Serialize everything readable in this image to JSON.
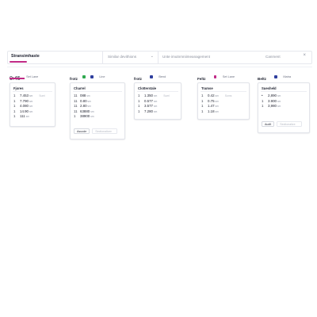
{
  "toolbar": {
    "search_label": "Stransimhaste",
    "select_value": "Similar devithions",
    "input_placeholder": "Unte imutnmniimeanagement",
    "input_current": "Canment"
  },
  "columns": [
    {
      "title": "0:45",
      "tag": "Set Lane",
      "card": {
        "title": "Fjores",
        "rows": [
          {
            "n": "1",
            "v": "7.453",
            "u": "sm",
            "t": "Sumi"
          },
          {
            "n": "1",
            "v": "7.790",
            "u": "sm",
            "t": ""
          },
          {
            "n": "1",
            "v": "4.080",
            "u": "sm",
            "t": ""
          },
          {
            "n": "1",
            "v": "14.90",
            "u": "sm",
            "t": ""
          },
          {
            "n": "1",
            "v": "111",
            "u": "sm",
            "t": ""
          }
        ]
      }
    },
    {
      "title": "frotz",
      "tag": "Line",
      "dots": [
        "#2fa84f",
        "#2f3f9e"
      ],
      "card": {
        "title": "Charrel",
        "rows": [
          {
            "n": "11",
            "v": "088",
            "u": "sm",
            "t": ""
          },
          {
            "n": "11",
            "v": "0.80",
            "u": "sm",
            "t": ""
          },
          {
            "n": "11",
            "v": "2.80",
            "u": "sm",
            "t": ""
          },
          {
            "n": "11",
            "v": "63880",
            "u": "sm",
            "t": ""
          },
          {
            "n": "1",
            "v": "38900",
            "u": "sm",
            "t": ""
          }
        ],
        "buttons": [
          "Asuode",
          "Sectionalizer"
        ]
      }
    },
    {
      "title": "frotz",
      "tag": "Bend",
      "dots": [
        "#2f3f9e"
      ],
      "card": {
        "title": "Clotterstale",
        "rows": [
          {
            "n": "1",
            "v": "1.350",
            "u": "sm",
            "t": "Suml"
          },
          {
            "n": "1",
            "v": "0.577",
            "u": "sm",
            "t": ""
          },
          {
            "n": "1",
            "v": "3.577",
            "u": "sm",
            "t": ""
          },
          {
            "n": "1",
            "v": "7.280",
            "u": "sm",
            "t": ""
          }
        ]
      }
    },
    {
      "title": "Feltz",
      "tag": "Set Lane",
      "dots": [
        "#c02a86"
      ],
      "card": {
        "title": "Tramse",
        "rows": [
          {
            "n": "1",
            "v": "0.42",
            "u": "sm",
            "t": "Sums"
          },
          {
            "n": "1",
            "v": "0.75",
            "u": "sm",
            "t": ""
          },
          {
            "n": "1",
            "v": "1.47",
            "u": "sm",
            "t": ""
          },
          {
            "n": "1",
            "v": "1.18",
            "u": "sm",
            "t": ""
          }
        ]
      }
    },
    {
      "title": "Beltz",
      "tag": "Matra",
      "dots": [
        "#2f3f9e"
      ],
      "card": {
        "title": "Suesheld",
        "rows": [
          {
            "n": "•",
            "v": "2,890",
            "u": "sm",
            "t": ""
          },
          {
            "n": "1",
            "v": "3.900",
            "u": "sm",
            "t": ""
          },
          {
            "n": "1",
            "v": "3,980",
            "u": "sm",
            "t": ""
          }
        ],
        "buttons": [
          "Audit",
          "Sectionalize"
        ]
      }
    }
  ]
}
